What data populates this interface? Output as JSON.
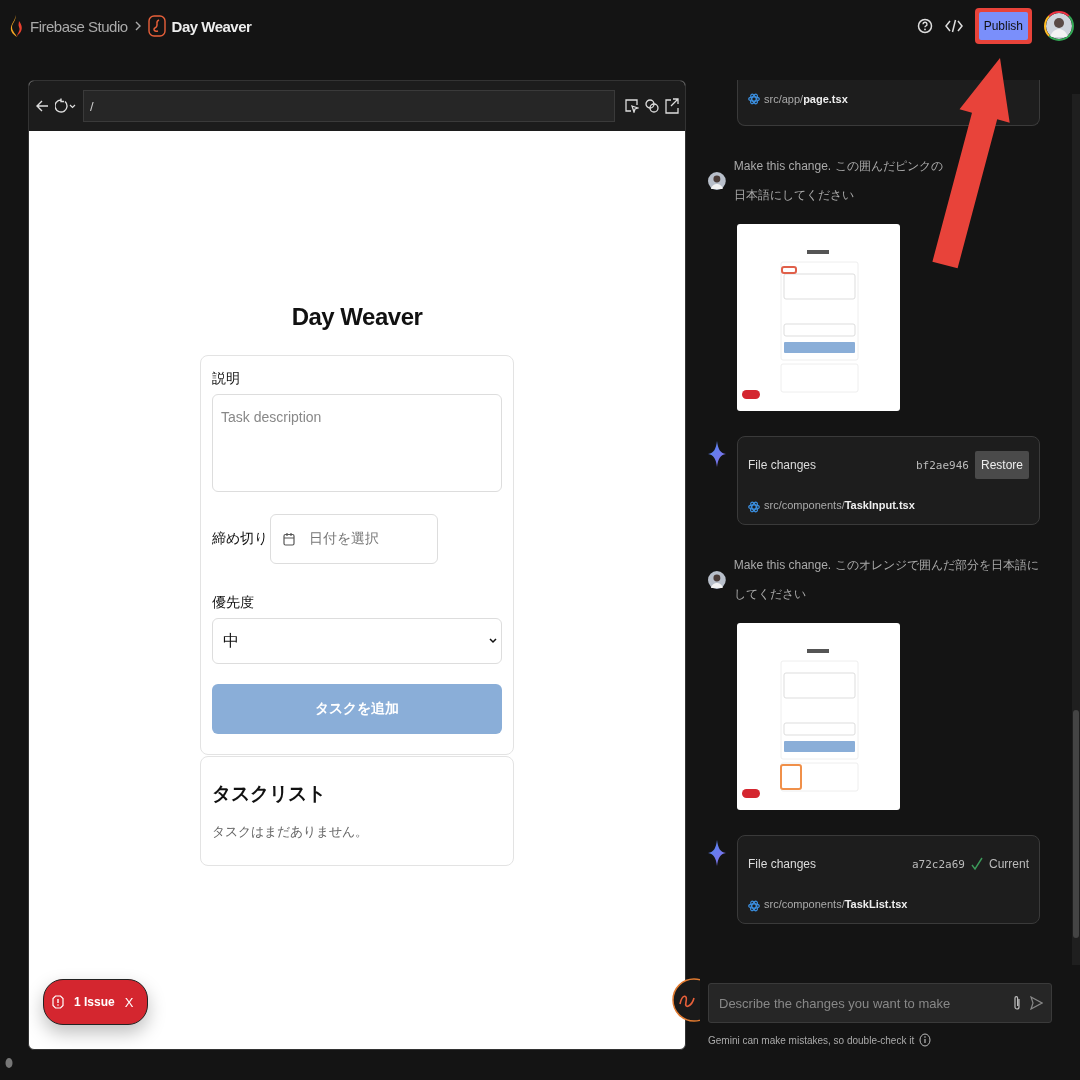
{
  "topbar": {
    "product": "Firebase Studio",
    "project": "Day Weaver",
    "publish": "Publish"
  },
  "preview": {
    "url": "/",
    "app_title": "Day Weaver",
    "description_label": "説明",
    "description_placeholder": "Task description",
    "deadline_label": "締め切り",
    "deadline_placeholder": "日付を選択",
    "priority_label": "優先度",
    "priority_value": "中",
    "add_button": "タスクを追加",
    "add_disabled": true,
    "list_title": "タスクリスト",
    "empty_text": "タスクはまだありません。",
    "issue_badge": "1 Issue",
    "issue_close": "X"
  },
  "chat": {
    "items": [
      {
        "kind": "file_tail",
        "path": "src/app/**page.tsx**"
      },
      {
        "kind": "user",
        "text_parts": [
          "Make this change. この囲んだピンクの",
          "日本語にしてください"
        ],
        "screenshot": {
          "kind": "picture",
          "color": "#e0604a"
        }
      },
      {
        "kind": "file_changes",
        "title": "File changes",
        "hash": "bf2ae946",
        "current": false,
        "action": "Restore",
        "path": "src/components/**TaskInput.tsx**"
      },
      {
        "kind": "user",
        "text_parts": [
          "Make this change. このオレンジで囲んだ部分を日本語にしてください"
        ],
        "screenshot": {
          "kind": "picture",
          "color": "#f0904a"
        }
      },
      {
        "kind": "file_changes",
        "title": "File changes",
        "hash": "a72c2a69",
        "current": true,
        "action": "Current",
        "path": "src/components/**TaskList.tsx**"
      }
    ],
    "input_placeholder": "Describe the changes you want to make",
    "disclaimer": "Gemini can make mistakes, so double-check it"
  }
}
